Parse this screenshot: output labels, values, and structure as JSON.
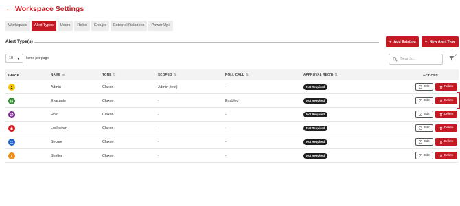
{
  "header": {
    "back_arrow": "←",
    "title": "Workspace Settings"
  },
  "tabs": [
    {
      "label": "Workspace",
      "active": false
    },
    {
      "label": "Alert Types",
      "active": true
    },
    {
      "label": "Users",
      "active": false
    },
    {
      "label": "Roles",
      "active": false
    },
    {
      "label": "Groups",
      "active": false
    },
    {
      "label": "External Relations",
      "active": false
    },
    {
      "label": "Power-Ups",
      "active": false
    }
  ],
  "section": {
    "title": "Alert Type(s)",
    "add_existing_label": "Add Existing",
    "new_alert_type_label": "New Alert Type"
  },
  "controls": {
    "per_page_value": "10",
    "per_page_label": "items per page",
    "search_placeholder": "Search...",
    "filter_count": "0"
  },
  "table": {
    "headers": {
      "image": "IMAGE",
      "name": "NAME",
      "tone": "TONE",
      "scoped": "SCOPED",
      "roll_call": "ROLL CALL",
      "approval": "APPROVAL REQ'D",
      "actions": "ACTIONS"
    },
    "edit_label": "Edit",
    "delete_label": "Delete",
    "rows": [
      {
        "icon": "alert-person-icon",
        "icon_bg": "#f2c200",
        "name": "Admin",
        "tone": "Claxon",
        "scoped": "Admin (test)",
        "roll_call": "-",
        "approval": "Not Required"
      },
      {
        "icon": "evacuate-people-icon",
        "icon_bg": "#2e8b2e",
        "name": "Evacuate",
        "tone": "Claxon",
        "scoped": "-",
        "roll_call": "Enabled",
        "approval": "Not Required"
      },
      {
        "icon": "hold-icon",
        "icon_bg": "#7a2a8c",
        "name": "Hold",
        "tone": "Claxon",
        "scoped": "-",
        "roll_call": "-",
        "approval": "Not Required"
      },
      {
        "icon": "lock-icon",
        "icon_bg": "#d4141c",
        "name": "Lockdown",
        "tone": "Claxon",
        "scoped": "-",
        "roll_call": "-",
        "approval": "Not Required"
      },
      {
        "icon": "secure-people-icon",
        "icon_bg": "#1e63c9",
        "name": "Secure",
        "tone": "Claxon",
        "scoped": "-",
        "roll_call": "-",
        "approval": "Not Required"
      },
      {
        "icon": "shelter-person-icon",
        "icon_bg": "#f08c10",
        "name": "Shelter",
        "tone": "Claxon",
        "scoped": "-",
        "roll_call": "-",
        "approval": "Not Required"
      }
    ]
  },
  "colors": {
    "brand": "#c41a24",
    "badge": "#1f1f1f",
    "header_bg": "#f3f3f3"
  }
}
